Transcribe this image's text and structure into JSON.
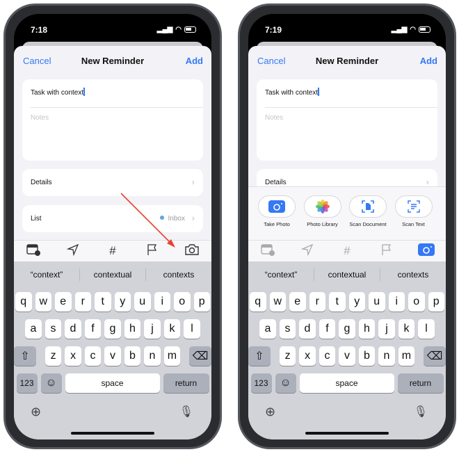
{
  "phones": [
    {
      "time": "7:18",
      "mode": "default",
      "active_tool": null
    },
    {
      "time": "7:19",
      "mode": "attachments",
      "active_tool": "camera"
    }
  ],
  "nav": {
    "cancel": "Cancel",
    "title": "New Reminder",
    "add": "Add"
  },
  "task_title": "Task with context",
  "notes_placeholder": "Notes",
  "details_label": "Details",
  "list_label": "List",
  "list_value": "Inbox",
  "attachments": [
    {
      "label": "Take Photo",
      "icon": "camera-icon"
    },
    {
      "label": "Photo Library",
      "icon": "photos-icon"
    },
    {
      "label": "Scan Document",
      "icon": "scan-document-icon"
    },
    {
      "label": "Scan Text",
      "icon": "scan-text-icon"
    }
  ],
  "toolbar": [
    "calendar-clock-icon",
    "location-icon",
    "tag-hash-icon",
    "flag-icon",
    "camera-icon"
  ],
  "suggestions": [
    "“context”",
    "contextual",
    "contexts"
  ],
  "keys": {
    "row1": [
      "q",
      "w",
      "e",
      "r",
      "t",
      "y",
      "u",
      "i",
      "o",
      "p"
    ],
    "row2": [
      "a",
      "s",
      "d",
      "f",
      "g",
      "h",
      "j",
      "k",
      "l"
    ],
    "row3": [
      "z",
      "x",
      "c",
      "v",
      "b",
      "n",
      "m"
    ],
    "numbers": "123",
    "space": "space",
    "return": "return"
  },
  "colors": {
    "accent": "#3478f6",
    "annotation_arrow": "#e8432e"
  }
}
